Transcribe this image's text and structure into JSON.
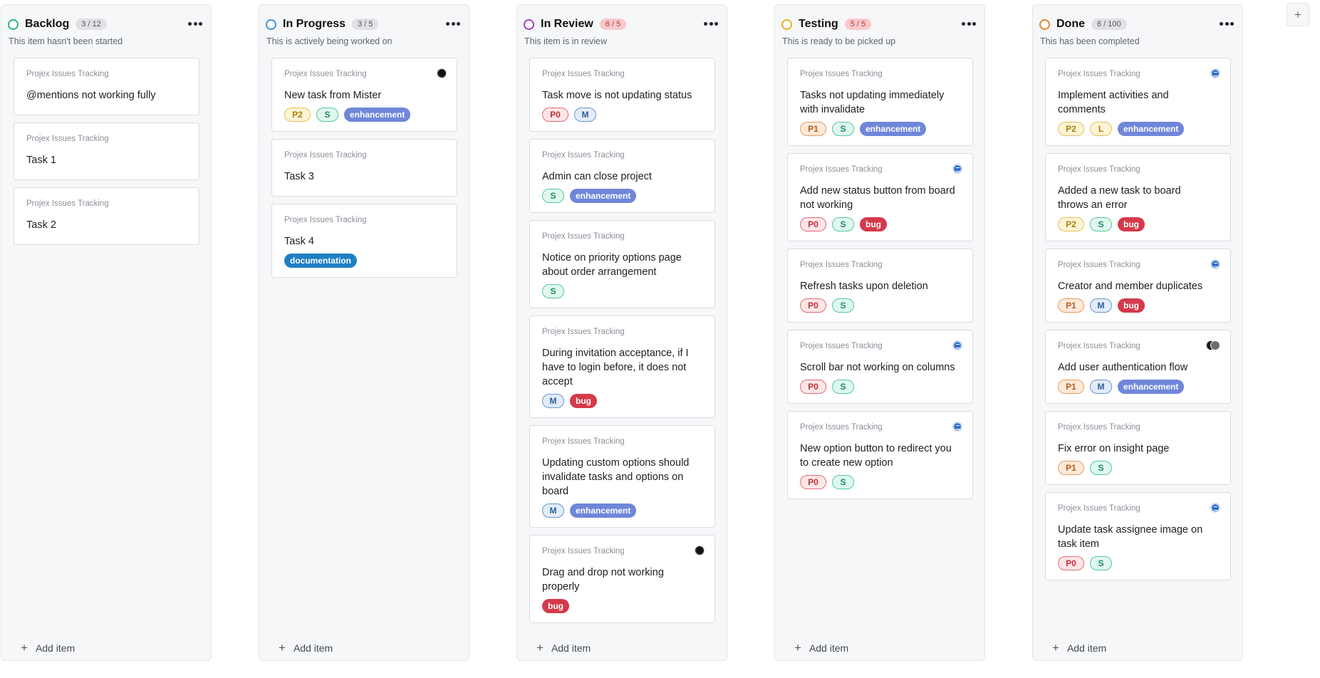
{
  "columns": [
    {
      "title": "Backlog",
      "count": "3 / 12",
      "count_over": false,
      "ring_color": "#2ab57d",
      "description": "This item hasn't been started",
      "add_label": "Add item",
      "cards": [
        {
          "project": "Projex Issues Tracking",
          "title": "@mentions not working fully",
          "tags": [],
          "avatar": ""
        },
        {
          "project": "Projex Issues Tracking",
          "title": "Task 1",
          "tags": [],
          "avatar": ""
        },
        {
          "project": "Projex Issues Tracking",
          "title": "Task 2",
          "tags": [],
          "avatar": ""
        }
      ]
    },
    {
      "title": "In Progress",
      "count": "3 / 5",
      "count_over": false,
      "ring_color": "#4a90d9",
      "description": "This is actively being worked on",
      "add_label": "Add item",
      "cards": [
        {
          "project": "Projex Issues Tracking",
          "title": "New task from Mister",
          "tags": [
            {
              "text": "P2",
              "kind": "p2"
            },
            {
              "text": "S",
              "kind": "sz-s"
            },
            {
              "text": "enhancement",
              "kind": "enh"
            }
          ],
          "avatar": "dark"
        },
        {
          "project": "Projex Issues Tracking",
          "title": "Task 3",
          "tags": [],
          "avatar": ""
        },
        {
          "project": "Projex Issues Tracking",
          "title": "Task 4",
          "tags": [
            {
              "text": "documentation",
              "kind": "doc"
            }
          ],
          "avatar": ""
        }
      ]
    },
    {
      "title": "In Review",
      "count": "6 / 5",
      "count_over": true,
      "ring_color": "#a23fc7",
      "description": "This item is in review",
      "add_label": "Add item",
      "cards": [
        {
          "project": "Projex Issues Tracking",
          "title": "Task move is not updating status",
          "tags": [
            {
              "text": "P0",
              "kind": "p0"
            },
            {
              "text": "M",
              "kind": "sz-m"
            }
          ],
          "avatar": ""
        },
        {
          "project": "Projex Issues Tracking",
          "title": "Admin can close project",
          "tags": [
            {
              "text": "S",
              "kind": "sz-s"
            },
            {
              "text": "enhancement",
              "kind": "enh"
            }
          ],
          "avatar": ""
        },
        {
          "project": "Projex Issues Tracking",
          "title": "Notice on priority options page about order arrangement",
          "tags": [
            {
              "text": "S",
              "kind": "sz-s"
            }
          ],
          "avatar": ""
        },
        {
          "project": "Projex Issues Tracking",
          "title": "During invitation acceptance, if I have to login before, it does not accept",
          "tags": [
            {
              "text": "M",
              "kind": "sz-m"
            },
            {
              "text": "bug",
              "kind": "bug"
            }
          ],
          "avatar": ""
        },
        {
          "project": "Projex Issues Tracking",
          "title": "Updating custom options should invalidate tasks and options on board",
          "tags": [
            {
              "text": "M",
              "kind": "sz-m"
            },
            {
              "text": "enhancement",
              "kind": "enh"
            }
          ],
          "avatar": ""
        },
        {
          "project": "Projex Issues Tracking",
          "title": "Drag and drop not working properly",
          "tags": [
            {
              "text": "bug",
              "kind": "bug"
            }
          ],
          "avatar": "dark"
        }
      ]
    },
    {
      "title": "Testing",
      "count": "5 / 5",
      "count_over": true,
      "ring_color": "#e0b21c",
      "description": "This is ready to be picked up",
      "add_label": "Add item",
      "cards": [
        {
          "project": "Projex Issues Tracking",
          "title": "Tasks not updating immediately with invalidate",
          "tags": [
            {
              "text": "P1",
              "kind": "p1"
            },
            {
              "text": "S",
              "kind": "sz-s"
            },
            {
              "text": "enhancement",
              "kind": "enh"
            }
          ],
          "avatar": ""
        },
        {
          "project": "Projex Issues Tracking",
          "title": "Add new status button from board not working",
          "tags": [
            {
              "text": "P0",
              "kind": "p0"
            },
            {
              "text": "S",
              "kind": "sz-s"
            },
            {
              "text": "bug",
              "kind": "bug"
            }
          ],
          "avatar": "blue"
        },
        {
          "project": "Projex Issues Tracking",
          "title": "Refresh tasks upon deletion",
          "tags": [
            {
              "text": "P0",
              "kind": "p0"
            },
            {
              "text": "S",
              "kind": "sz-s"
            }
          ],
          "avatar": ""
        },
        {
          "project": "Projex Issues Tracking",
          "title": "Scroll bar not working on columns",
          "tags": [
            {
              "text": "P0",
              "kind": "p0"
            },
            {
              "text": "S",
              "kind": "sz-s"
            }
          ],
          "avatar": "blue"
        },
        {
          "project": "Projex Issues Tracking",
          "title": "New option button to redirect you to create new option",
          "tags": [
            {
              "text": "P0",
              "kind": "p0"
            },
            {
              "text": "S",
              "kind": "sz-s"
            }
          ],
          "avatar": "blue"
        }
      ]
    },
    {
      "title": "Done",
      "count": "6 / 100",
      "count_over": false,
      "ring_color": "#e2892b",
      "description": "This has been completed",
      "add_label": "Add item",
      "cards": [
        {
          "project": "Projex Issues Tracking",
          "title": "Implement activities and comments",
          "tags": [
            {
              "text": "P2",
              "kind": "p2"
            },
            {
              "text": "L",
              "kind": "sz-l"
            },
            {
              "text": "enhancement",
              "kind": "enh"
            }
          ],
          "avatar": "blue"
        },
        {
          "project": "Projex Issues Tracking",
          "title": "Added a new task to board throws an error",
          "tags": [
            {
              "text": "P2",
              "kind": "p2"
            },
            {
              "text": "S",
              "kind": "sz-s"
            },
            {
              "text": "bug",
              "kind": "bug"
            }
          ],
          "avatar": ""
        },
        {
          "project": "Projex Issues Tracking",
          "title": "Creator and member duplicates",
          "tags": [
            {
              "text": "P1",
              "kind": "p1"
            },
            {
              "text": "M",
              "kind": "sz-m"
            },
            {
              "text": "bug",
              "kind": "bug"
            }
          ],
          "avatar": "blue"
        },
        {
          "project": "Projex Issues Tracking",
          "title": "Add user authentication flow",
          "tags": [
            {
              "text": "P1",
              "kind": "p1"
            },
            {
              "text": "M",
              "kind": "sz-m"
            },
            {
              "text": "enhancement",
              "kind": "enh"
            }
          ],
          "avatar": "pair"
        },
        {
          "project": "Projex Issues Tracking",
          "title": "Fix error on insight page",
          "tags": [
            {
              "text": "P1",
              "kind": "p1"
            },
            {
              "text": "S",
              "kind": "sz-s"
            }
          ],
          "avatar": ""
        },
        {
          "project": "Projex Issues Tracking",
          "title": "Update task assignee image on task item",
          "tags": [
            {
              "text": "P0",
              "kind": "p0"
            },
            {
              "text": "S",
              "kind": "sz-s"
            }
          ],
          "avatar": "blue"
        }
      ]
    }
  ],
  "add_column": {
    "icon": "plus-icon",
    "glyph": "+"
  }
}
